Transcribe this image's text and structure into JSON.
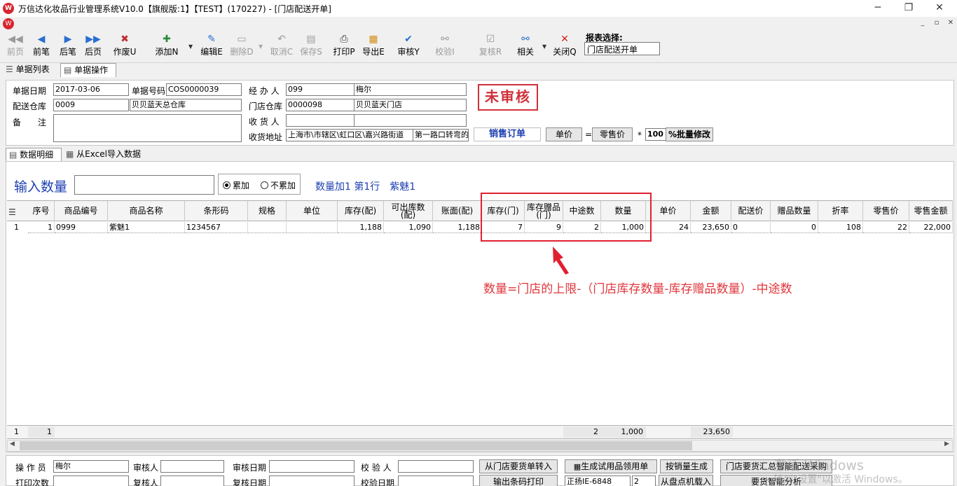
{
  "window": {
    "title": "万信达化妆品行业管理系统V10.0【旗舰版:1】【TEST】(170227) - [门店配送开单]",
    "logo_text": "W",
    "controls": [
      "─",
      "❐",
      "✕"
    ],
    "mdi_controls": [
      "_",
      "▫",
      "✕"
    ]
  },
  "toolbar": {
    "items": [
      {
        "label": "前页",
        "icon": "◀◀",
        "enabled": false
      },
      {
        "label": "前笔",
        "icon": "◀",
        "enabled": true
      },
      {
        "label": "后笔",
        "icon": "▶",
        "enabled": true
      },
      {
        "label": "后页",
        "icon": "▶▶",
        "enabled": true
      },
      {
        "label": "作废U",
        "icon": "✖",
        "enabled": true
      },
      {
        "label": "添加N",
        "icon": "✚",
        "enabled": true
      },
      {
        "label": "编辑E",
        "icon": "✎",
        "enabled": true
      },
      {
        "label": "删除D",
        "icon": "▭",
        "enabled": false
      },
      {
        "label": "取消C",
        "icon": "↶",
        "enabled": false
      },
      {
        "label": "保存S",
        "icon": "▤",
        "enabled": false
      },
      {
        "label": "打印P",
        "icon": "⎙",
        "enabled": true
      },
      {
        "label": "导出E",
        "icon": "▦",
        "enabled": true
      },
      {
        "label": "审核Y",
        "icon": "✔",
        "enabled": true
      },
      {
        "label": "校验I",
        "icon": "⚯",
        "enabled": false
      },
      {
        "label": "复核R",
        "icon": "☑",
        "enabled": false
      },
      {
        "label": "相关",
        "icon": "⚯",
        "enabled": true
      },
      {
        "label": "关闭Q",
        "icon": "✕",
        "enabled": true
      }
    ],
    "report_label": "报表选择:",
    "report_value": "门店配送开单"
  },
  "top_tabs": [
    "单据列表",
    "单据操作"
  ],
  "header": {
    "doc_date_label": "单据日期",
    "doc_date": "2017-03-06",
    "doc_no_label": "单据号码",
    "doc_no": "COS0000039",
    "handler_label": "经 办 人",
    "handler_code": "099",
    "handler_name": "梅尔",
    "warehouse_label": "配送仓库",
    "warehouse_code": "0009",
    "warehouse_name": "贝贝蓝天总仓库",
    "store_wh_label": "门店仓库",
    "store_wh_code": "0000098",
    "store_wh_name": "贝贝蓝天门店",
    "remark_label": "备　　注",
    "receiver_label": "收 货 人",
    "address_label": "收货地址",
    "address1": "上海市\\市辖区\\虹口区\\嘉兴路街道",
    "address2": "第一路口转弯的",
    "status": "未审核",
    "order_type": "销售订单",
    "unit_price_btn": "单价",
    "eq": "=",
    "retail_price_btn": "零售价",
    "star": "*",
    "pct": "100",
    "batch_btn": "%批量修改"
  },
  "inner_tabs": [
    "数据明细",
    "从Excel导入数据"
  ],
  "entry": {
    "qty_label": "输入数量",
    "radio_accum": "累加",
    "radio_no_accum": "不累加",
    "info": "数量加1 第1行　紫魅1"
  },
  "grid": {
    "columns": [
      "序号",
      "商品编号",
      "商品名称",
      "条形码",
      "规格",
      "单位",
      "库存(配)",
      "可出库数(配)",
      "账面(配)",
      "库存(门)",
      "库存赠品(门)",
      "中途数",
      "数量",
      "单价",
      "金额",
      "配送价",
      "赠品数量",
      "折率",
      "零售价",
      "零售金额"
    ],
    "rows": [
      {
        "rownum": "1",
        "cells": [
          "1",
          "0999",
          "紫魅1",
          "1234567",
          "",
          "",
          "1,188",
          "1,090",
          "1,188",
          "7",
          "9",
          "2",
          "1,000",
          "24",
          "23,650",
          "0",
          "0",
          "108",
          "22",
          "22,000"
        ]
      }
    ],
    "footer": {
      "rownum": "1",
      "seq": "1",
      "transit": "2",
      "qty": "1,000",
      "amount": "23,650"
    }
  },
  "annotation": "数量=门店的上限-（门店库存数量-库存赠品数量）-中途数",
  "bottom": {
    "operator_label": "操 作 员",
    "operator": "梅尔",
    "auditor_label": "审核人",
    "audit_date_label": "审核日期",
    "checker_label": "校 验 人",
    "print_count_label": "打印次数",
    "reviewer_label": "复核人",
    "review_date_label": "复核日期",
    "check_date_label": "校验日期",
    "btn_from_store_req": "从门店要货单转入",
    "btn_print_barcode": "输出条码打印",
    "btn_gen_trial": "生成试用品领用单",
    "device_value": "正扬IE-6848",
    "spin_value": "2",
    "btn_by_sales": "按销量生成",
    "btn_from_inventory": "从盘点机载入",
    "btn_store_req_purchase": "门店要货汇总智能配送采购",
    "btn_req_analysis": "要货智能分析",
    "watermark1": "激活 Windows",
    "watermark2": "转到\"设置\"以激活 Windows。"
  },
  "colors": {
    "accent_blue": "#1d3fb0",
    "stamp_red": "#d0303a",
    "annotation_red": "#e0363c"
  }
}
